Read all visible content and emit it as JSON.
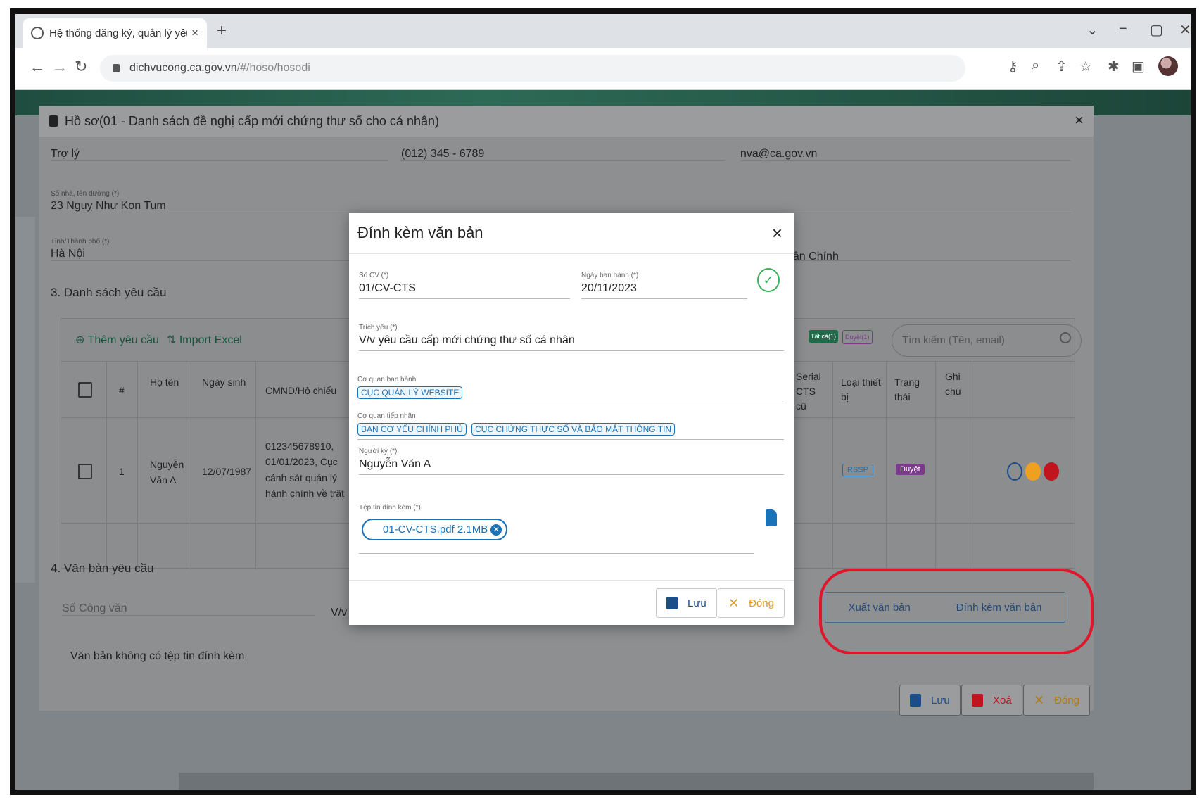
{
  "browser": {
    "tab_title": "Hệ thống đăng ký, quản lý yêu :",
    "tab_close": "×",
    "new_tab": "+",
    "url_host": "dichvucong.ca.gov.vn",
    "url_path": "/#/hoso/hosodi",
    "win_controls": [
      "⌄",
      "−",
      "▢",
      "✕"
    ]
  },
  "dialog": {
    "title": "Hồ sơ(01 - Danh sách đề nghị cấp mới chứng thư số cho cá nhân)",
    "close": "×",
    "fields": {
      "chuc_vu": "Trợ lý",
      "dien_thoai": "(012) 345 - 6789",
      "email": "nva@ca.gov.vn",
      "so_nha_label": "Số nhà, tên đường (*)",
      "so_nha": "23 Nguỵ Như Kon Tum",
      "tinh_label": "Tỉnh/Thành phố (*)",
      "tinh": "Hà Nội",
      "partial_right": "hân Chính"
    },
    "section3": "3. Danh sách yêu cầu",
    "toolbar": {
      "add": "Thêm yêu cầu",
      "import": "Import Excel",
      "chip1": "Tất cả(1)",
      "chip2": "Duyệt(1)",
      "search_placeholder": "Tìm kiếm (Tên, email)"
    },
    "table": {
      "headers": [
        "#",
        "Họ tên",
        "Ngày sinh",
        "CMND/Hộ chiếu",
        "Serial CTS cũ",
        "Loại thiết bị",
        "Trạng thái",
        "Ghi chú"
      ],
      "row": {
        "index": "1",
        "name": "Nguyễn Văn A",
        "dob": "12/07/1987",
        "id_info": "012345678910, 01/01/2023, Cục cảnh sát quản lý hành chính về trật tự xã hội",
        "device": "RSSP",
        "status": "Duyệt"
      }
    },
    "section4": "4. Văn bản yêu cầu",
    "so_cong_van_placeholder": "Số Công văn",
    "partial_vv": "V/v",
    "no_attachment": "Văn bản không có tệp tin đính kèm",
    "actions": {
      "export": "Xuất văn bản",
      "attach": "Đính kèm văn bản"
    },
    "footer": {
      "save": "Lưu",
      "delete": "Xoá",
      "close": "Đóng"
    }
  },
  "modal": {
    "title": "Đính kèm văn bản",
    "close": "×",
    "so_cv_label": "Số CV (*)",
    "so_cv": "01/CV-CTS",
    "ngay_label": "Ngày ban hành (*)",
    "ngay": "20/11/2023",
    "trich_yeu_label": "Trích yếu (*)",
    "trich_yeu": "V/v yêu cầu cấp mới chứng thư số cá nhân",
    "co_quan_ban_hanh_label": "Cơ quan ban hành",
    "co_quan_ban_hanh": [
      "CỤC QUẢN LÝ WEBSITE"
    ],
    "co_quan_tiep_nhan_label": "Cơ quan tiếp nhận",
    "co_quan_tiep_nhan": [
      "BAN CƠ YẾU CHÍNH PHỦ",
      "CỤC CHỨNG THỰC SỐ VÀ BẢO MẬT THÔNG TIN"
    ],
    "nguoi_ky_label": "Người ký (*)",
    "nguoi_ky": "Nguyễn Văn A",
    "tep_label": "Tệp tin đính kèm (*)",
    "file_name": "01-CV-CTS.pdf",
    "file_size": "2.1MB",
    "save": "Lưu",
    "close_btn": "Đóng"
  },
  "colors": {
    "highlight": "#e0162b",
    "primary": "#1a72b8",
    "success": "#3cae5c",
    "warning": "#f0a020"
  }
}
